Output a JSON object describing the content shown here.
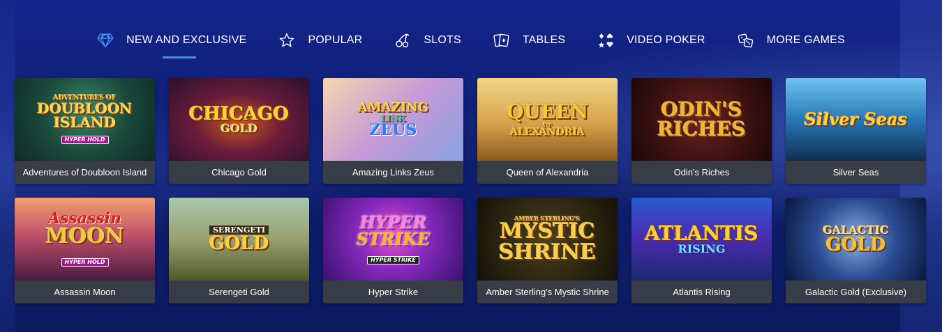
{
  "nav": {
    "items": [
      {
        "label": "NEW AND EXCLUSIVE",
        "icon": "diamond-icon",
        "active": true
      },
      {
        "label": "POPULAR",
        "icon": "star-icon",
        "active": false
      },
      {
        "label": "SLOTS",
        "icon": "cherries-icon",
        "active": false
      },
      {
        "label": "TABLES",
        "icon": "cards-icon",
        "active": false
      },
      {
        "label": "VIDEO POKER",
        "icon": "poker-chips-icon",
        "active": false
      },
      {
        "label": "MORE GAMES",
        "icon": "dice-icon",
        "active": false
      }
    ],
    "accent_color": "#4a8ef0"
  },
  "games": [
    {
      "title": "Adventures of Doubloon Island",
      "art_line1": "ADVENTURES OF",
      "art_line2": "DOUBLOON",
      "art_line3": "ISLAND",
      "badge": "HYPER HOLD"
    },
    {
      "title": "Chicago Gold",
      "art_line1": "CHICAGO",
      "art_line2": "GOLD",
      "art_line3": ""
    },
    {
      "title": "Amazing Links Zeus",
      "art_line1": "AMAZING",
      "art_line2": "LINK",
      "art_line3": "ZEUS"
    },
    {
      "title": "Queen of Alexandria",
      "art_line1": "QUEEN",
      "art_line2": "OF",
      "art_line3": "ALEXANDRIA"
    },
    {
      "title": "Odin's Riches",
      "art_line1": "ODIN'S",
      "art_line2": "RICHES",
      "art_line3": ""
    },
    {
      "title": "Silver Seas",
      "art_line1": "Silver Seas",
      "art_line2": "",
      "art_line3": ""
    },
    {
      "title": "Assassin Moon",
      "art_line1": "Assassin",
      "art_line2": "MOON",
      "art_line3": "",
      "badge": "HYPER HOLD"
    },
    {
      "title": "Serengeti Gold",
      "art_line1": "SERENGETI",
      "art_line2": "GOLD",
      "art_line3": ""
    },
    {
      "title": "Hyper Strike",
      "art_line1": "HYPER",
      "art_line2": "STRIKE",
      "art_line3": "",
      "badge": "HYPER STRIKE"
    },
    {
      "title": "Amber Sterling's Mystic Shrine",
      "art_line1": "AMBER STERLING'S",
      "art_line2": "MYSTIC",
      "art_line3": "SHRINE"
    },
    {
      "title": "Atlantis Rising",
      "art_line1": "ATLANTIS",
      "art_line2": "RISING",
      "art_line3": ""
    },
    {
      "title": "Galactic Gold (Exclusive)",
      "art_line1": "GALACTIC",
      "art_line2": "GOLD",
      "art_line3": ""
    }
  ]
}
